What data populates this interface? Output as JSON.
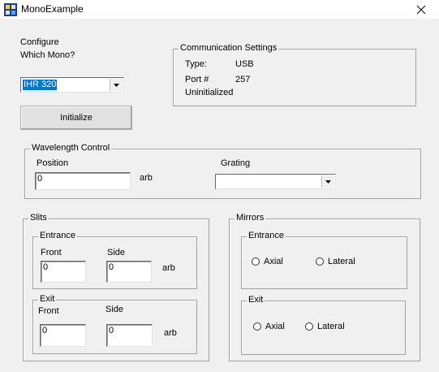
{
  "window": {
    "title": "MonoExample"
  },
  "configure": {
    "line1": "Configure",
    "line2": "Which Mono?",
    "mono_select": "IHR 320",
    "initialize_label": "Initialize"
  },
  "comm": {
    "legend": "Communication Settings",
    "type_label": "Type:",
    "type_value": "USB",
    "port_label": "Port #",
    "port_value": "257",
    "status": "Uninitialized"
  },
  "wavelength": {
    "legend": "Wavelength Control",
    "position_label": "Position",
    "position_value": "0",
    "unit": "arb",
    "grating_label": "Grating",
    "grating_value": ""
  },
  "slits": {
    "legend": "Slits",
    "entrance": {
      "legend": "Entrance",
      "front_label": "Front",
      "front_value": "0",
      "side_label": "Side",
      "side_value": "0",
      "unit": "arb"
    },
    "exit": {
      "legend": "Exit",
      "front_label": "Front",
      "front_value": "0",
      "side_label": "Side",
      "side_value": "0",
      "unit": "arb"
    }
  },
  "mirrors": {
    "legend": "Mirrors",
    "entrance": {
      "legend": "Entrance",
      "axial": "Axial",
      "lateral": "Lateral"
    },
    "exit": {
      "legend": "Exit",
      "axial": "Axial",
      "lateral": "Lateral"
    }
  },
  "icons": {
    "app": "app-icon",
    "close": "close-icon",
    "dropdown": "chevron-down-icon"
  }
}
